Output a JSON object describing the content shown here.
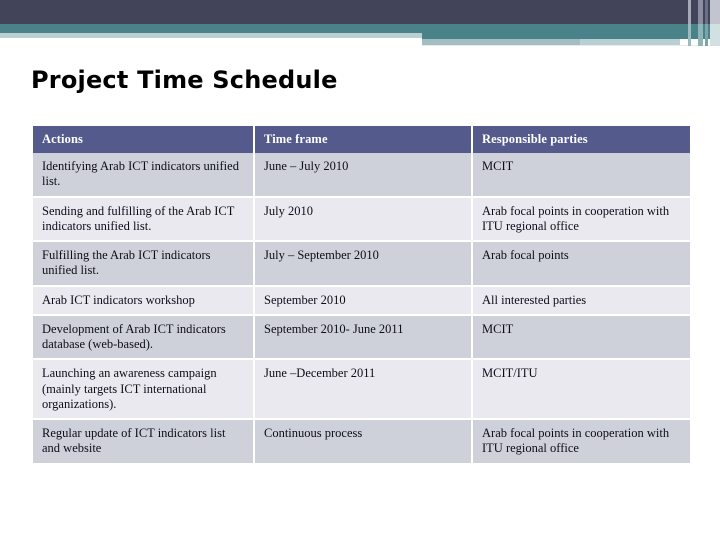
{
  "slide": {
    "title": "Project Time Schedule"
  },
  "theme": {
    "banner_navy": "#424559",
    "banner_teal": "#4a8289",
    "banner_pale": "#b9cfd2",
    "table_header_bg": "#545a8c",
    "row_shade_dark": "#ced0da",
    "row_shade_light": "#e9e9ef"
  },
  "table": {
    "headers": [
      "Actions",
      "Time frame",
      "Responsible parties"
    ],
    "rows": [
      {
        "action": "Identifying  Arab ICT indicators unified list.",
        "time_frame": "June – July 2010",
        "responsible": "MCIT"
      },
      {
        "action": "Sending and fulfilling of the Arab ICT indicators unified list.",
        "time_frame": "July 2010",
        "responsible": "Arab focal points in cooperation with ITU regional office"
      },
      {
        "action": "Fulfilling the  Arab ICT indicators unified list.",
        "time_frame": "July – September  2010",
        "responsible": "Arab focal points"
      },
      {
        "action": "Arab ICT indicators workshop",
        "time_frame": "September 2010",
        "responsible": "All interested parties"
      },
      {
        "action": "Development of Arab ICT indicators database (web-based).",
        "time_frame": "September 2010- June 2011",
        "responsible": "MCIT"
      },
      {
        "action": "Launching an awareness campaign (mainly targets ICT international organizations).",
        "time_frame": "June –December 2011",
        "responsible": "MCIT/ITU"
      },
      {
        "action": "Regular update of ICT indicators list and website",
        "time_frame": "Continuous process",
        "responsible": "Arab focal points in cooperation with ITU regional office"
      }
    ]
  }
}
